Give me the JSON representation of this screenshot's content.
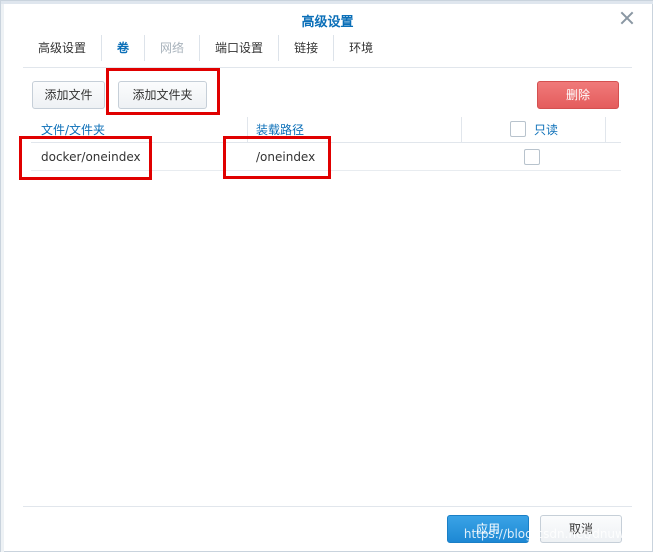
{
  "dialog": {
    "title": "高级设置",
    "close_icon": "close-icon"
  },
  "tabs": [
    {
      "label": "高级设置",
      "state": "normal"
    },
    {
      "label": "卷",
      "state": "active"
    },
    {
      "label": "网络",
      "state": "disabled"
    },
    {
      "label": "端口设置",
      "state": "normal"
    },
    {
      "label": "链接",
      "state": "normal"
    },
    {
      "label": "环境",
      "state": "normal"
    }
  ],
  "toolbar": {
    "add_file_label": "添加文件",
    "add_folder_label": "添加文件夹",
    "delete_label": "删除"
  },
  "table": {
    "headers": {
      "file_folder": "文件/文件夹",
      "mount_path": "装载路径",
      "read_only": "只读"
    },
    "rows": [
      {
        "file_folder": "docker/oneindex",
        "mount_path": "/oneindex",
        "read_only": false
      }
    ]
  },
  "footer": {
    "apply_label": "应用",
    "cancel_label": "取消",
    "watermark": "https://blog.csdn.net/dnuwjw"
  },
  "colors": {
    "accent": "#0b6fb8",
    "danger": "#e45c5c",
    "primary": "#1d88d4",
    "highlight": "#e00000"
  }
}
